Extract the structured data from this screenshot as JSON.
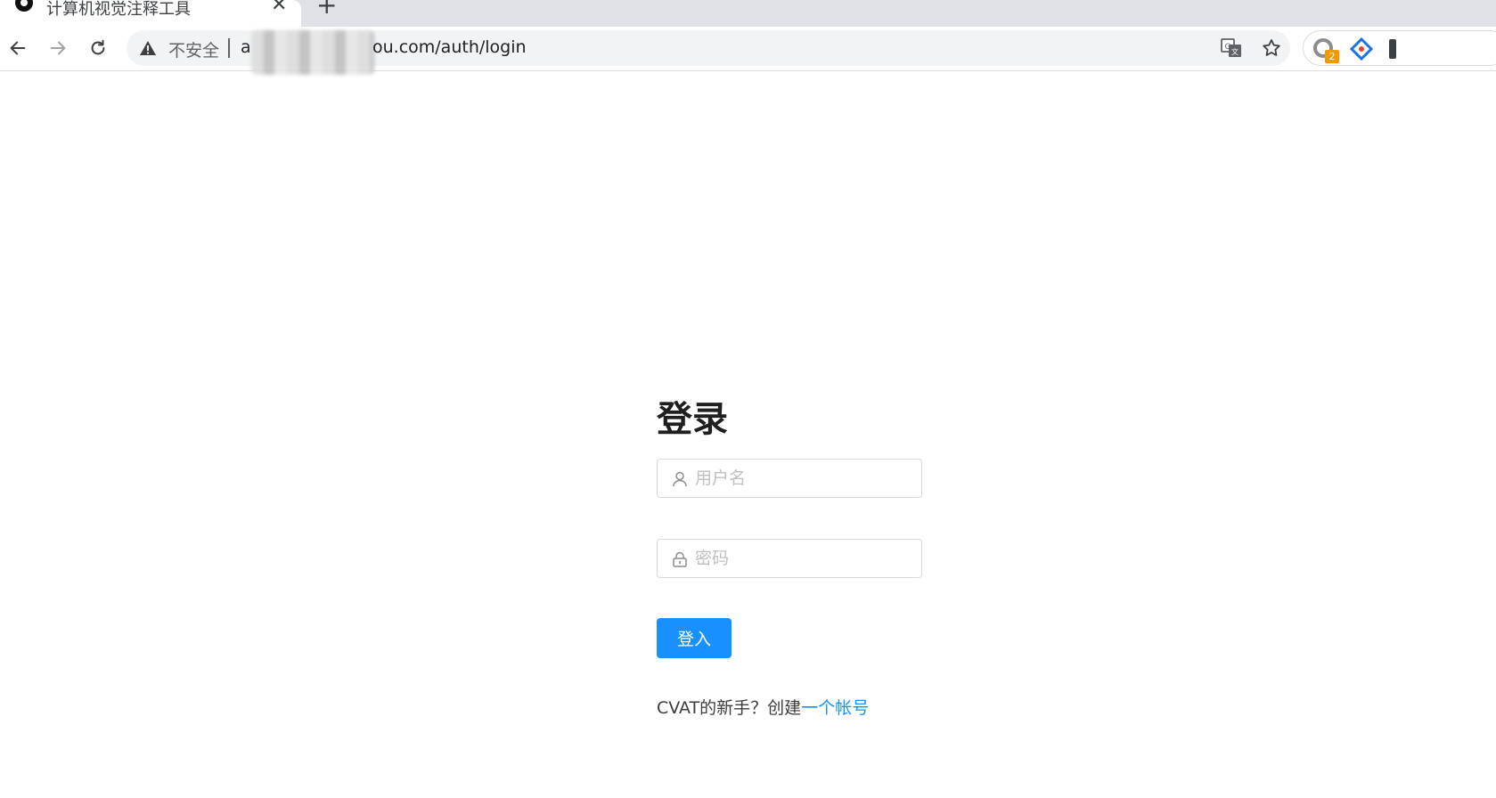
{
  "browser": {
    "tab": {
      "title": "计算机视觉注释工具",
      "close_label": "✕"
    },
    "new_tab_label": "+",
    "omnibox": {
      "security_label": "不安全",
      "url_start": "a",
      "url_end": "ou.com/auth/login"
    },
    "extension_badge": "2"
  },
  "login": {
    "title": "登录",
    "username_placeholder": "用户名",
    "password_placeholder": "密码",
    "submit_label": "登入",
    "signup_prompt": "CVAT的新手？创建",
    "signup_link": "一个帐号"
  },
  "colors": {
    "primary": "#1890ff",
    "tabstrip": "#dee1e6",
    "omnibox": "#f1f3f4"
  }
}
